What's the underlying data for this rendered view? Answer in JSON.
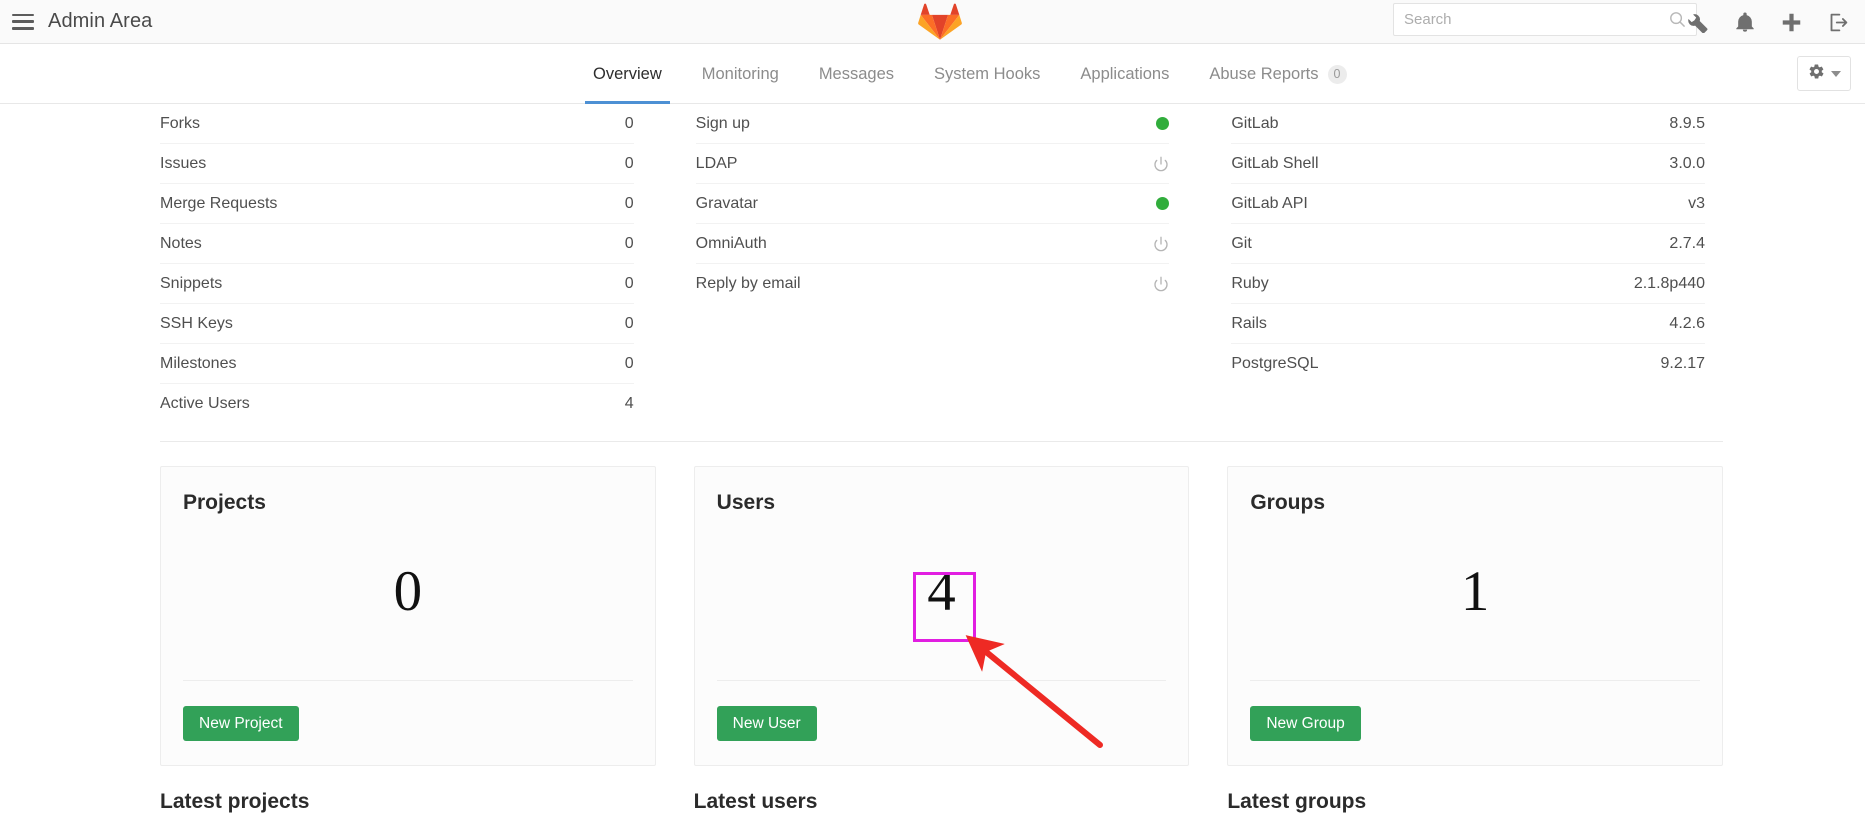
{
  "topbar": {
    "title": "Admin Area",
    "menu_icon": "hamburger-icon",
    "logo_icon": "gitlab-logo-icon",
    "search": {
      "value": "",
      "placeholder": "Search",
      "icon": "search-icon"
    },
    "icons": [
      {
        "name": "wrench-icon",
        "label": "Admin tools"
      },
      {
        "name": "bell-icon",
        "label": "Notifications"
      },
      {
        "name": "plus-icon",
        "label": "New"
      },
      {
        "name": "sign-out-icon",
        "label": "Sign out"
      }
    ]
  },
  "nav": {
    "tabs": [
      {
        "label": "Overview",
        "active": true,
        "badge": null
      },
      {
        "label": "Monitoring",
        "active": false,
        "badge": null
      },
      {
        "label": "Messages",
        "active": false,
        "badge": null
      },
      {
        "label": "System Hooks",
        "active": false,
        "badge": null
      },
      {
        "label": "Applications",
        "active": false,
        "badge": null
      },
      {
        "label": "Abuse Reports",
        "active": false,
        "badge": "0"
      }
    ],
    "settings_button": {
      "icon": "gear-icon",
      "caret": "chevron-down-icon"
    },
    "active_underline_color": "#4d90d4"
  },
  "stats": {
    "counts": [
      {
        "label": "Forks",
        "value": "0"
      },
      {
        "label": "Issues",
        "value": "0"
      },
      {
        "label": "Merge Requests",
        "value": "0"
      },
      {
        "label": "Notes",
        "value": "0"
      },
      {
        "label": "Snippets",
        "value": "0"
      },
      {
        "label": "SSH Keys",
        "value": "0"
      },
      {
        "label": "Milestones",
        "value": "0"
      },
      {
        "label": "Active Users",
        "value": "4"
      }
    ],
    "features": [
      {
        "label": "Sign up",
        "status": "enabled",
        "icon": "green-dot-icon"
      },
      {
        "label": "LDAP",
        "status": "disabled",
        "icon": "power-icon"
      },
      {
        "label": "Gravatar",
        "status": "enabled",
        "icon": "green-dot-icon"
      },
      {
        "label": "OmniAuth",
        "status": "disabled",
        "icon": "power-icon"
      },
      {
        "label": "Reply by email",
        "status": "disabled",
        "icon": "power-icon"
      }
    ],
    "components": [
      {
        "label": "GitLab",
        "value": "8.9.5"
      },
      {
        "label": "GitLab Shell",
        "value": "3.0.0"
      },
      {
        "label": "GitLab API",
        "value": "v3"
      },
      {
        "label": "Git",
        "value": "2.7.4"
      },
      {
        "label": "Ruby",
        "value": "2.1.8p440"
      },
      {
        "label": "Rails",
        "value": "4.2.6"
      },
      {
        "label": "PostgreSQL",
        "value": "9.2.17"
      }
    ],
    "status_enabled_color": "#31ad3c",
    "status_disabled_color": "#b5b5b5"
  },
  "cards": [
    {
      "title": "Projects",
      "count": "0",
      "button": "New Project"
    },
    {
      "title": "Users",
      "count": "4",
      "button": "New User"
    },
    {
      "title": "Groups",
      "count": "1",
      "button": "New Group"
    }
  ],
  "latest": [
    {
      "heading": "Latest projects"
    },
    {
      "heading": "Latest users"
    },
    {
      "heading": "Latest groups"
    }
  ],
  "annotations": {
    "highlight_box": {
      "target": "users-card-count",
      "color": "#e11ee1"
    },
    "arrow": {
      "color": "#ee2a24",
      "points_to": "users-card-count"
    }
  },
  "theme": {
    "button_green": "#32a158",
    "accent_blue": "#4d90d4"
  }
}
